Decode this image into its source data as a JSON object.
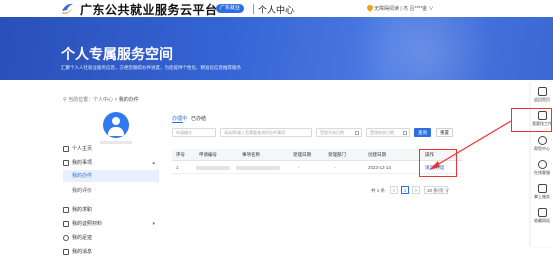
{
  "header": {
    "site_title": "广东公共就业服务云平台",
    "beta_label": "广东就业",
    "center_title": "个人中心",
    "location_text": "无障碍阅读",
    "user_text": "杰 吕****金 ∨"
  },
  "banner": {
    "title": "个人专属服务空间",
    "subtitle": "汇聚个人人社就业服务信息，方便您跟踪办件进度，为您提供个性化、精准化信息推荐服务"
  },
  "breadcrumb": {
    "prefix": "当前位置：",
    "parent": "个人中心",
    "separator": " > ",
    "current": "我的办件"
  },
  "sidebar": {
    "items": [
      {
        "label": "个人主页",
        "icon": "home-icon"
      },
      {
        "label": "我的事项",
        "icon": "task-icon",
        "caret": "▴"
      },
      {
        "label": "我的求职",
        "icon": "briefcase-icon"
      },
      {
        "label": "我的证照材料",
        "icon": "certificate-icon",
        "caret": "▾"
      },
      {
        "label": "我的足迹",
        "icon": "footprint-icon"
      },
      {
        "label": "我的消息",
        "icon": "message-icon"
      }
    ],
    "sub_items": [
      {
        "label": "我的办件",
        "active": true
      },
      {
        "label": "我的评价",
        "active": false
      }
    ]
  },
  "tabs": [
    {
      "label": "办理中",
      "active": true
    },
    {
      "label": "已办结",
      "active": false
    }
  ],
  "filters": {
    "case_no_placeholder": "申请编号",
    "item_name_placeholder": "请选择/输入您需要查询的办件事项",
    "start_date_placeholder": "受理开始日期",
    "end_date_placeholder": "受理结束日期",
    "query_label": "查询",
    "reset_label": "重置"
  },
  "table": {
    "columns": [
      "序号",
      "申请编号",
      "事项名称",
      "受理日期",
      "受理部门",
      "创建日期",
      "操作"
    ],
    "rows": [
      {
        "index": "1",
        "accept_date": "-",
        "department": "-",
        "created": "2023-12-13",
        "action": "填写/办理"
      }
    ]
  },
  "pagination": {
    "total": "共 1 条",
    "prev": "<",
    "page": "1",
    "next": ">",
    "page_size": "10 条/页 ∨"
  },
  "floatbar": {
    "items": [
      {
        "label": "返回首页",
        "icon": "home-icon"
      },
      {
        "label": "我要找工作",
        "icon": "document-icon"
      },
      {
        "label": "帮您中心",
        "icon": "help-icon"
      },
      {
        "label": "在线客服",
        "icon": "service-icon"
      },
      {
        "label": "掌上服务",
        "icon": "mobile-icon"
      },
      {
        "label": "收藏网站",
        "icon": "star-icon"
      }
    ]
  },
  "colors": {
    "accent": "#2d6fe3",
    "highlight": "#e33333",
    "banner": "#3464d4"
  }
}
